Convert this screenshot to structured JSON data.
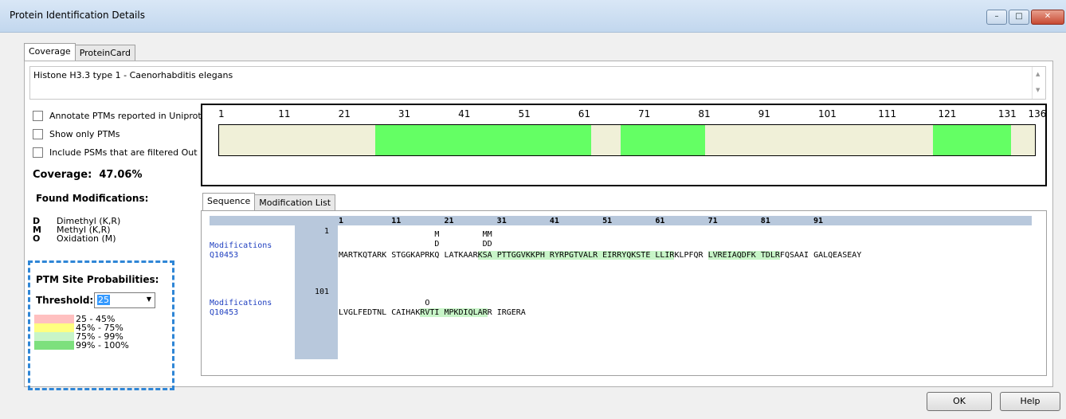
{
  "window": {
    "title": "Protein Identification Details",
    "buttons": [
      "minimize",
      "maximize",
      "close"
    ]
  },
  "main_tabs": [
    {
      "label": "Coverage",
      "active": true
    },
    {
      "label": "ProteinCard",
      "active": false
    }
  ],
  "protein_description": "Histone H3.3 type 1 - Caenorhabditis elegans",
  "options": {
    "annotate_ptms": {
      "label": "Annotate PTMs reported in Uniprot",
      "checked": false
    },
    "show_only_ptms": {
      "label": "Show only PTMs",
      "checked": false
    },
    "include_filtered_psms": {
      "label": "Include PSMs that are filtered Out",
      "checked": false
    }
  },
  "coverage": {
    "label": "Coverage:",
    "value": "47.06%"
  },
  "found_modifications": {
    "title": "Found Modifications:",
    "items": [
      {
        "symbol": "D",
        "name": "Dimethyl (K,R)"
      },
      {
        "symbol": "M",
        "name": "Methyl (K,R)"
      },
      {
        "symbol": "O",
        "name": "Oxidation (M)"
      }
    ]
  },
  "ptm_site_probabilities": {
    "title": "PTM Site Probabilities:",
    "threshold_label": "Threshold:",
    "threshold_value": "25",
    "legend": [
      {
        "range": "25 - 45%",
        "color": "#ffc0c0"
      },
      {
        "range": "45% - 75%",
        "color": "#ffff80"
      },
      {
        "range": "75% - 99%",
        "color": "#c8f5c8"
      },
      {
        "range": "99% - 100%",
        "color": "#7de07d"
      }
    ]
  },
  "coverage_map": {
    "ruler": [
      "1",
      "11",
      "21",
      "31",
      "41",
      "51",
      "61",
      "71",
      "81",
      "91",
      "101",
      "111",
      "121",
      "131",
      "136"
    ],
    "length": 136,
    "covered_ranges": [
      [
        27,
        62
      ],
      [
        68,
        81
      ],
      [
        120,
        132
      ]
    ],
    "base_color": "#f0f0d8",
    "covered_color": "#64ff64"
  },
  "sequence_tabs": [
    {
      "label": "Sequence",
      "active": true
    },
    {
      "label": "Modification List",
      "active": false
    }
  ],
  "sequence_view": {
    "ruler": [
      "1",
      "11",
      "21",
      "31",
      "41",
      "51",
      "61",
      "71",
      "81",
      "91"
    ],
    "blocks": [
      {
        "start": "1",
        "mods_label": "Modifications",
        "accession": "Q10453",
        "mod_line_1": "                    M         MM",
        "mod_line_2": "                    D         DD",
        "sequence": [
          {
            "text": "MARTKQTARK STGGKAPRKQ LATKAAR",
            "hl": false
          },
          {
            "text": "KSA PTTGGVKKPH RYRPGTVALR EIRRYQKSTE LLIR",
            "hl": true
          },
          {
            "text": "KLPFQR ",
            "hl": false
          },
          {
            "text": "LVREIAQDFK TDLR",
            "hl": true
          },
          {
            "text": "FQSAAI GALQEASEAY",
            "hl": false
          }
        ]
      },
      {
        "start": "101",
        "mods_label": "Modifications",
        "accession": "Q10453",
        "mod_line_1": "                  O",
        "mod_line_2": "",
        "sequence": [
          {
            "text": "LVGLFEDTNL CAIHAK",
            "hl": false
          },
          {
            "text": "RVTI MPKDIQLAR",
            "hl": true
          },
          {
            "text": "R IRGERA",
            "hl": false
          }
        ]
      }
    ]
  },
  "footer_buttons": {
    "ok": "OK",
    "help": "Help"
  }
}
